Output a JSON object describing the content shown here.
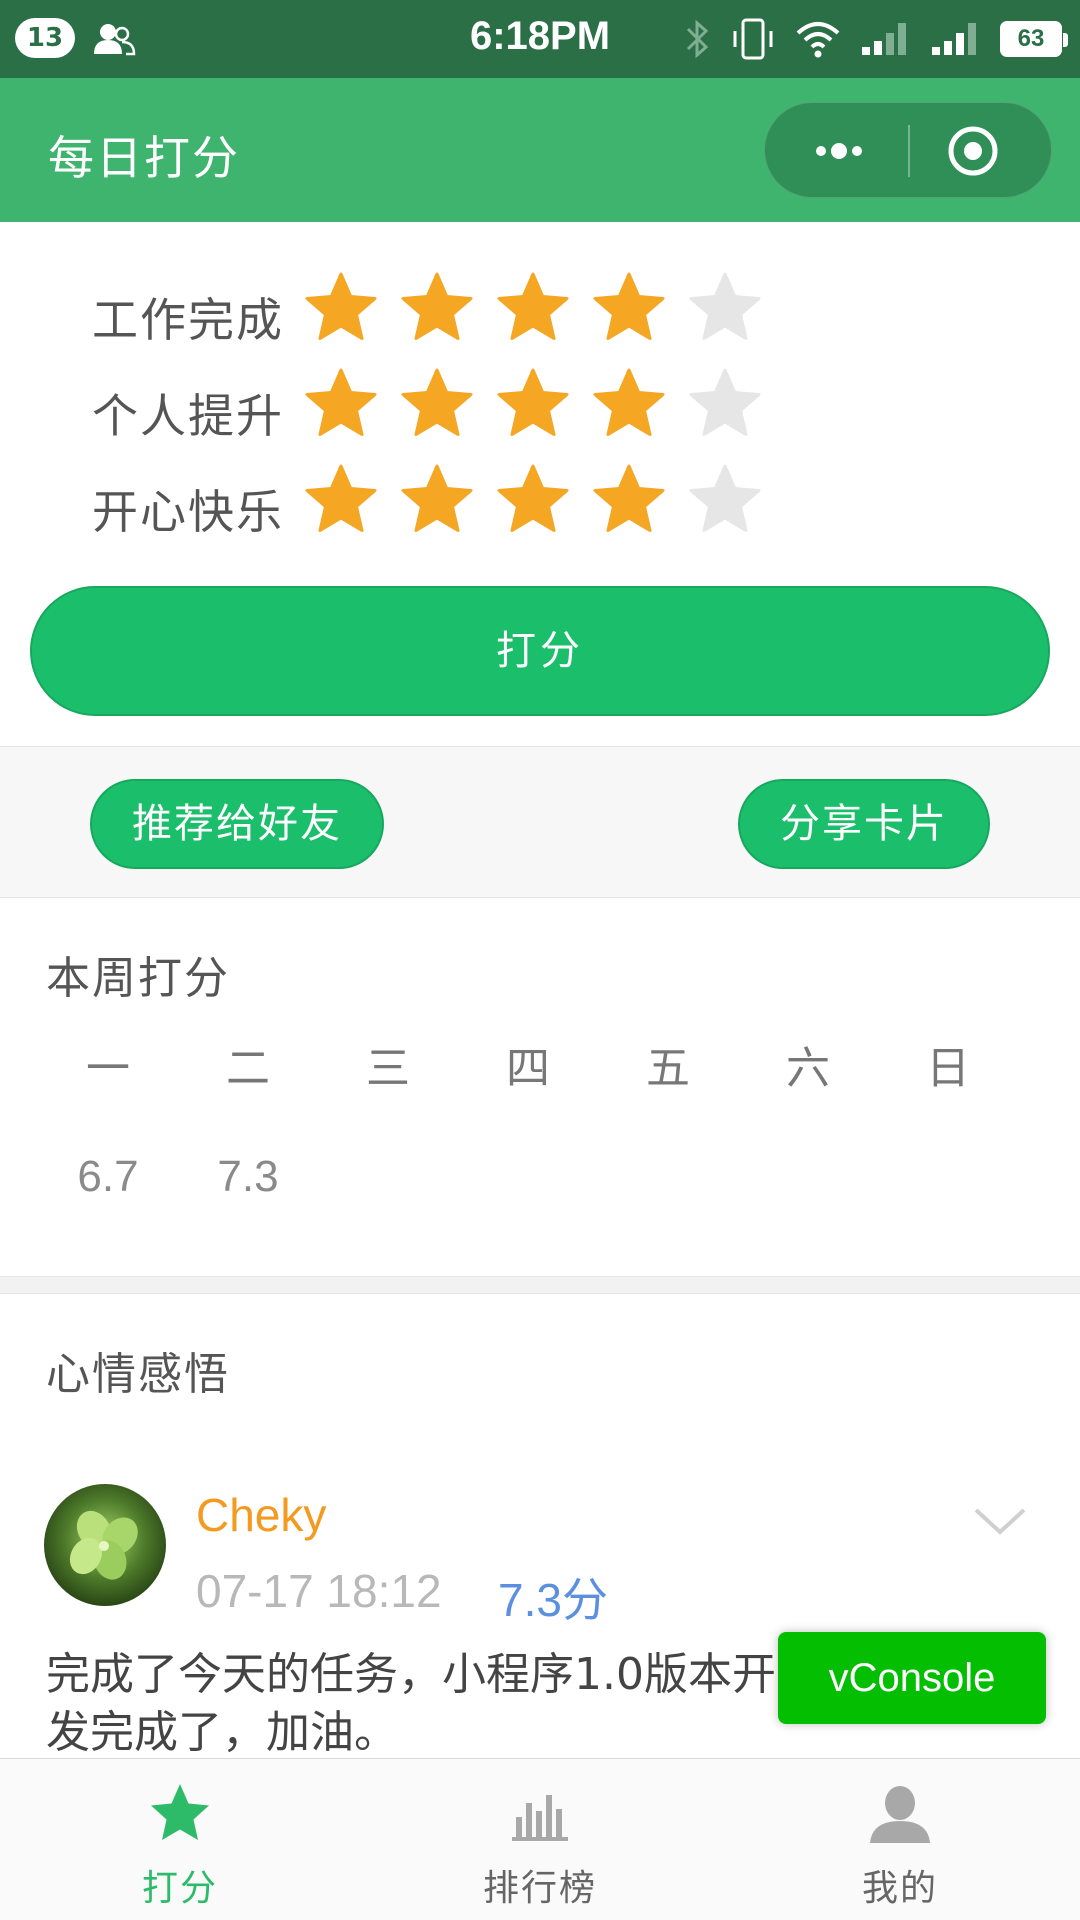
{
  "status_bar": {
    "notification_count": "13",
    "time": "6:18PM",
    "battery": "63"
  },
  "nav": {
    "title": "每日打分"
  },
  "ratings": [
    {
      "label": "工作完成",
      "value": 4,
      "max": 5
    },
    {
      "label": "个人提升",
      "value": 4,
      "max": 5
    },
    {
      "label": "开心快乐",
      "value": 4,
      "max": 5
    }
  ],
  "colors": {
    "star_on": "#f5a623",
    "star_off": "#e6e6e6",
    "primary": "#1bbf6b",
    "nav_bg": "#3eb46e"
  },
  "actions": {
    "submit_label": "打分",
    "recommend_label": "推荐给好友",
    "share_label": "分享卡片"
  },
  "week": {
    "title": "本周打分",
    "days": [
      "一",
      "二",
      "三",
      "四",
      "五",
      "六",
      "日"
    ],
    "scores": [
      "6.7",
      "7.3",
      "",
      "",
      "",
      "",
      ""
    ]
  },
  "mood": {
    "title": "心情感悟",
    "post": {
      "author": "Cheky",
      "time": "07-17 18:12",
      "score": "7.3分",
      "content": "完成了今天的任务，小程序1.0版本开发完成了，加油。"
    }
  },
  "vconsole_label": "vConsole",
  "tabbar": {
    "items": [
      {
        "label": "打分",
        "icon": "star-icon",
        "active": true
      },
      {
        "label": "排行榜",
        "icon": "bar-chart-icon",
        "active": false
      },
      {
        "label": "我的",
        "icon": "user-icon",
        "active": false
      }
    ]
  }
}
